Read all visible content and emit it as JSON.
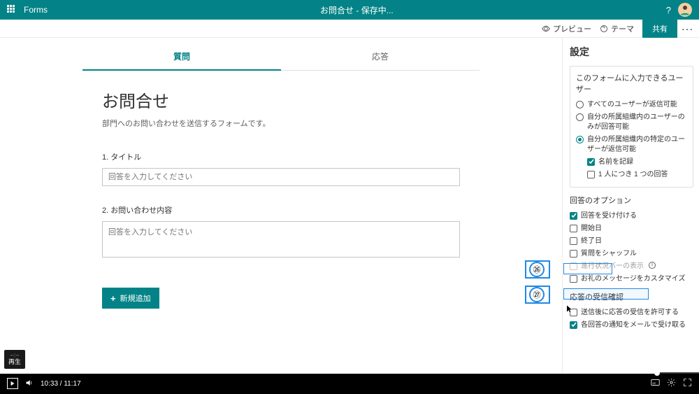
{
  "header": {
    "app_name": "Forms",
    "center_label": "お問合せ - 保存中...",
    "help_tooltip": "?",
    "preview_label": "プレビュー",
    "theme_label": "テーマ",
    "share_label": "共有",
    "more_label": "···"
  },
  "tabs": {
    "questions": "質問",
    "responses": "応答"
  },
  "form": {
    "title": "お問合せ",
    "description": "部門へのお問い合わせを送信するフォームです。",
    "q1_label": "1. タイトル",
    "q1_placeholder": "回答を入力してください",
    "q2_label": "2. お問い合わせ内容",
    "q2_placeholder": "回答を入力してください",
    "add_button": "新規追加"
  },
  "settings": {
    "title": "設定",
    "who_can_fill": "このフォームに入力できるユーザー",
    "opt_anyone": "すべてのユーザーが返信可能",
    "opt_org": "自分の所属組織内のユーザーのみが回答可能",
    "opt_specific": "自分の所属組織内の特定のユーザーが返信可能",
    "record_name": "名前を記録",
    "one_response": "1 人につき 1 つの回答",
    "response_options": "回答のオプション",
    "accept_responses": "回答を受け付ける",
    "start_date": "開始日",
    "end_date": "終了日",
    "shuffle": "質問をシャッフル",
    "progress_bar": "進行状況バーの表示",
    "thank_you": "お礼のメッセージをカスタマイズ",
    "receipt_section": "応答の受信確認",
    "allow_receipt": "送信後に応答の受信を許可する",
    "email_each": "各回答の通知をメールで受け取る"
  },
  "callouts": {
    "n26": "㉖",
    "n27": "㉗"
  },
  "video": {
    "time": "10:33 / 11:17",
    "replay": "再生"
  }
}
